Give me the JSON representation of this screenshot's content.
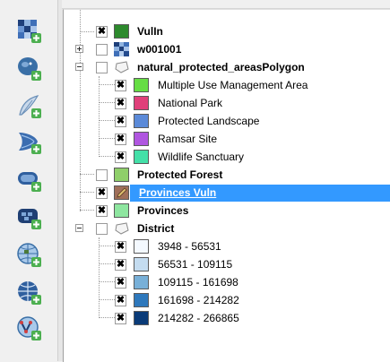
{
  "toolbar": {
    "buttons": [
      {
        "name": "add-raster-layer-icon"
      },
      {
        "name": "add-postgis-layer-icon"
      },
      {
        "name": "add-spatialite-layer-icon"
      },
      {
        "name": "add-mssql-layer-icon"
      },
      {
        "name": "add-oracle-layer-icon"
      },
      {
        "name": "add-db2-layer-icon"
      },
      {
        "name": "add-wms-layer-icon"
      },
      {
        "name": "add-wcs-layer-icon"
      },
      {
        "name": "add-wfs-layer-icon"
      },
      {
        "name": "add-virtual-layer-icon"
      }
    ]
  },
  "layers": {
    "vulln": {
      "label": "VulIn",
      "checked": true,
      "color": "#2d8a2d"
    },
    "w001001": {
      "label": "w001001",
      "checked": false
    },
    "protected_areas": {
      "label": "natural_protected_areasPolygon",
      "checked": false,
      "classes": [
        {
          "label": "Multiple Use Management Area",
          "color": "#66dd44",
          "checked": true
        },
        {
          "label": "National Park",
          "color": "#e0407a",
          "checked": true
        },
        {
          "label": "Protected Landscape",
          "color": "#5b8ad8",
          "checked": true
        },
        {
          "label": "Ramsar Site",
          "color": "#b056e0",
          "checked": true
        },
        {
          "label": "Wildlife Sanctuary",
          "color": "#44e0a8",
          "checked": true
        }
      ]
    },
    "protected_forest": {
      "label": "Protected Forest",
      "checked": false,
      "color": "#8fcf6a"
    },
    "provinces_vuln": {
      "label": "Provinces Vuln",
      "checked": true,
      "color": "#a0705a"
    },
    "provinces": {
      "label": "Provinces",
      "checked": true,
      "color": "#8ee6a0"
    },
    "district": {
      "label": "District",
      "checked": false,
      "classes": [
        {
          "label": "3948 - 56531",
          "color": "#f4f9ff",
          "checked": true
        },
        {
          "label": "56531 - 109115",
          "color": "#c4dcf0",
          "checked": true
        },
        {
          "label": "109115 - 161698",
          "color": "#78b0d8",
          "checked": true
        },
        {
          "label": "161698 - 214282",
          "color": "#2e78bc",
          "checked": true
        },
        {
          "label": "214282 - 266865",
          "color": "#0a3b78",
          "checked": true
        }
      ]
    }
  }
}
